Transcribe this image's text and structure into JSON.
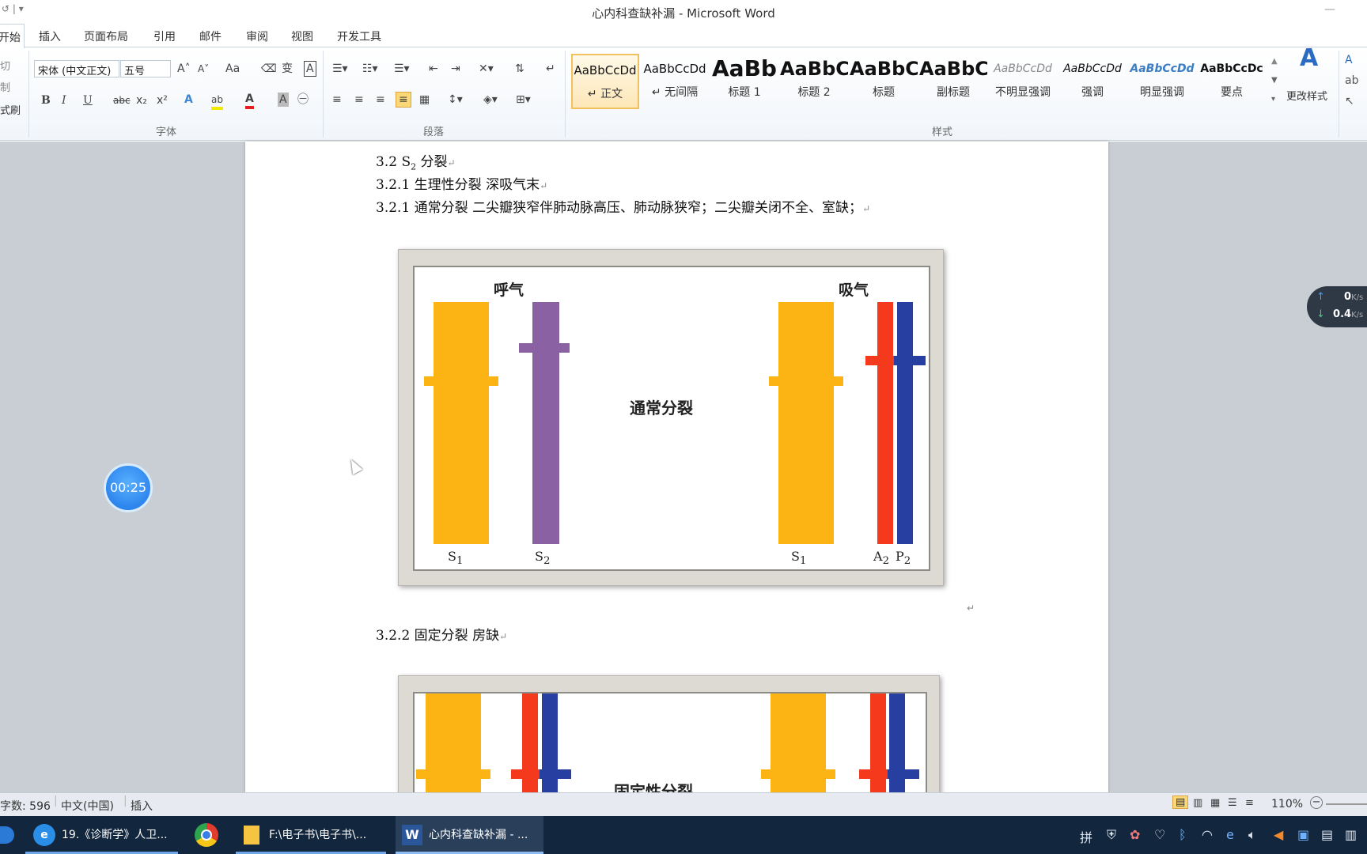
{
  "window": {
    "title": "心内科查缺补漏 - Microsoft Word",
    "minimize": "—"
  },
  "quick_access": {
    "undo": "↺",
    "dropdown": "▾"
  },
  "tabs": [
    "开始",
    "插入",
    "页面布局",
    "引用",
    "邮件",
    "审阅",
    "视图",
    "开发工具"
  ],
  "clipboard": {
    "cut": "切",
    "copy": "制",
    "format_painter": "式刷"
  },
  "font": {
    "name": "宋体 (中文正文)",
    "size": "五号",
    "grow": "A˄",
    "shrink": "A˅",
    "change_case": "Aa",
    "clear": "⌫",
    "pinyin": "变",
    "border": "A",
    "bold": "B",
    "italic": "I",
    "underline": "U",
    "strike": "abc",
    "subscript": "x₂",
    "superscript": "x²",
    "effects": "A",
    "highlight": "ab",
    "color": "A",
    "shading": "A",
    "enclose": "㊀",
    "group_label": "字体"
  },
  "paragraph": {
    "group_label": "段落"
  },
  "styles": {
    "group_label": "样式",
    "items": [
      {
        "sample": "AaBbCcDd",
        "name": "↵ 正文"
      },
      {
        "sample": "AaBbCcDd",
        "name": "↵ 无间隔"
      },
      {
        "sample": "AaBb",
        "name": "标题 1"
      },
      {
        "sample": "AaBbC",
        "name": "标题 2"
      },
      {
        "sample": "AaBbC",
        "name": "标题"
      },
      {
        "sample": "AaBbC",
        "name": "副标题"
      },
      {
        "sample": "AaBbCcDd",
        "name": "不明显强调"
      },
      {
        "sample": "AaBbCcDd",
        "name": "强调"
      },
      {
        "sample": "AaBbCcDd",
        "name": "明显强调"
      },
      {
        "sample": "AaBbCcDc",
        "name": "要点"
      }
    ],
    "change_styles": "更改样式"
  },
  "document": {
    "line1_prefix": "3.2 S",
    "line1_sub": "2",
    "line1_suffix": " 分裂",
    "line2": "3.2.1  生理性分裂    深吸气末",
    "line3": "3.2.1  通常分裂  二尖瓣狭窄伴肺动脉高压、肺动脉狭窄；二尖瓣关闭不全、室缺；",
    "line4": "3.2.2 固定分裂  房缺",
    "para_mark": "↵"
  },
  "figure1": {
    "label_exhale": "呼气",
    "label_inhale": "吸气",
    "center": "通常分裂",
    "s1": "S",
    "s1_sub": "1",
    "s2": "S",
    "s2_sub": "2",
    "a2": "A",
    "a2_sub": "2",
    "p2": "P",
    "p2_sub": "2"
  },
  "figure2": {
    "center": "固定性分裂"
  },
  "overlays": {
    "timer": "00:25",
    "net_up": "0",
    "net_up_unit": "K/s",
    "net_down": "0.4",
    "net_down_unit": "K/s"
  },
  "status": {
    "word_count": "字数: 596",
    "language": "中文(中国)",
    "mode": "插入",
    "zoom": "110%"
  },
  "taskbar": {
    "ie_window": "19.《诊断学》人卫...",
    "folder_window": "F:\\电子书\\电子书\\...",
    "word_window": "心内科查缺补漏 - ..."
  },
  "colors": {
    "orange": "#fcb415",
    "purple": "#8a62a3",
    "red": "#f5391c",
    "blue": "#263fa0",
    "ribbon_bg": "#f1f5fa",
    "taskbar": "#12263d"
  }
}
